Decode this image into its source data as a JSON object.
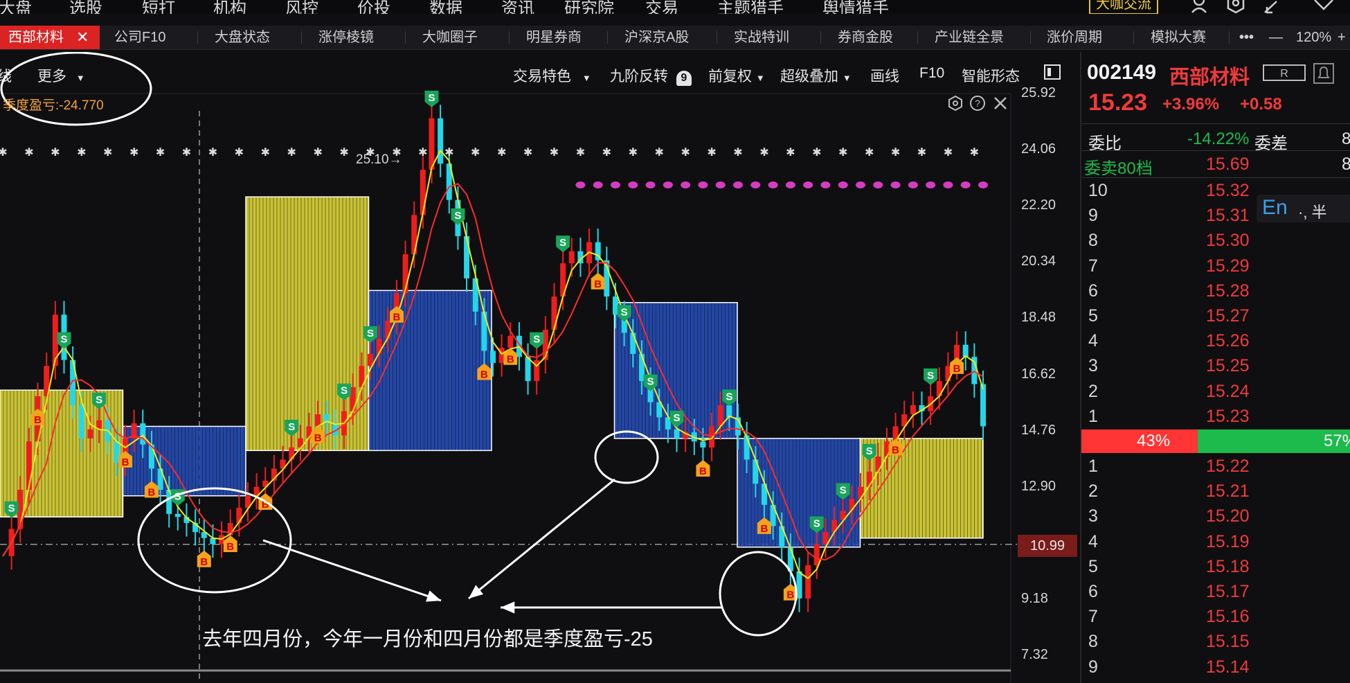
{
  "top_nav": {
    "items": [
      "大盘",
      "选股",
      "短打",
      "机构",
      "风控",
      "价投",
      "数据",
      "资讯",
      "研究院",
      "交易",
      "主题猎手",
      "舆情猎手"
    ],
    "brand_button": "大咖交流"
  },
  "tabs": [
    {
      "label": "西部材料",
      "active": true
    },
    {
      "label": "公司F10"
    },
    {
      "label": "大盘状态"
    },
    {
      "label": "涨停棱镜"
    },
    {
      "label": "大咖圈子"
    },
    {
      "label": "明星券商"
    },
    {
      "label": "沪深京A股"
    },
    {
      "label": "实战特训"
    },
    {
      "label": "券商金股"
    },
    {
      "label": "产业链全景"
    },
    {
      "label": "涨价周期"
    },
    {
      "label": "模拟大赛"
    }
  ],
  "tabbar_right": {
    "more": "•••",
    "minus": "—",
    "zoom": "120%",
    "plus": "+"
  },
  "toolbar": {
    "left_partial": "线",
    "more": "更多",
    "trade_feature": "交易特色",
    "nine_reverse": "九阶反转",
    "nine_badge": "9",
    "fuquan": "前复权",
    "overlay": "超级叠加",
    "draw": "画线",
    "f10": "F10",
    "smart_pattern": "智能形态"
  },
  "indicator_label": "季度盈亏:-24.770",
  "peak_label": "25.10→",
  "current_price_tag": "10.99",
  "annotation": "去年四月份，今年一月份和四月份都是季度盈亏-25",
  "colors": {
    "up": "#f01d1d",
    "down": "#22d8e8",
    "ma_yellow": "#f2ea12",
    "ma_red": "#ff2a2a",
    "bar_yellow": "#e9e23a",
    "bar_blue": "#2750bf",
    "buy_orange": "#f5a31b",
    "sell_green": "#18a55a",
    "accent_red": "#dc2323",
    "accent_green": "#1cbb4c"
  },
  "chart_data": {
    "type": "candlestick",
    "y_ticks": [
      25.92,
      24.06,
      22.2,
      20.34,
      18.48,
      16.62,
      14.76,
      12.9,
      9.18,
      7.32
    ],
    "ylim": [
      6.4,
      27.3
    ],
    "close_series": [
      10.6,
      11.5,
      12.8,
      14.4,
      15.9,
      16.9,
      18.6,
      17.1,
      15.6,
      14.5,
      14.8,
      15.1,
      14.4,
      13.7,
      14.5,
      15.0,
      14.3,
      13.5,
      12.8,
      12.0,
      11.9,
      11.7,
      11.4,
      11.2,
      11.0,
      11.3,
      11.7,
      12.2,
      12.6,
      12.9,
      13.1,
      13.5,
      13.8,
      14.2,
      14.5,
      14.9,
      15.3,
      15.0,
      14.6,
      15.4,
      16.2,
      16.9,
      17.3,
      17.8,
      18.4,
      19.3,
      20.6,
      21.9,
      23.4,
      25.1,
      23.6,
      22.4,
      21.2,
      19.8,
      18.7,
      17.4,
      17.0,
      17.5,
      17.9,
      17.2,
      16.4,
      17.1,
      18.1,
      19.2,
      20.3,
      20.7,
      20.3,
      21.0,
      20.4,
      19.2,
      18.6,
      18.0,
      17.3,
      16.4,
      15.7,
      15.2,
      14.8,
      14.5,
      14.7,
      14.4,
      14.2,
      14.9,
      15.6,
      15.2,
      14.6,
      13.8,
      13.0,
      12.3,
      11.6,
      10.9,
      10.1,
      9.2,
      10.3,
      11.0,
      11.4,
      11.8,
      12.1,
      12.5,
      12.9,
      13.4,
      13.9,
      14.4,
      14.9,
      15.3,
      15.6,
      15.4,
      15.9,
      16.4,
      16.9,
      17.6,
      17.2,
      16.3,
      14.9
    ],
    "step_bands": [
      {
        "color": "yellow",
        "top": 16.1,
        "base": 11.9
      },
      {
        "color": "blue",
        "top": 14.9,
        "base": 12.6
      },
      {
        "color": "yellow",
        "top": 22.5,
        "base": 14.1
      },
      {
        "color": "blue",
        "top": 19.4,
        "base": 14.1
      },
      {
        "color": "blue",
        "top": 19.0,
        "base": 19.0
      },
      {
        "color": "blue",
        "top": 19.0,
        "base": 14.5
      },
      {
        "color": "blue",
        "top": 14.5,
        "base": 10.9
      },
      {
        "color": "yellow",
        "top": 14.5,
        "base": 11.2
      }
    ],
    "signals": [
      {
        "t": "S"
      },
      {
        "t": "B"
      },
      {
        "t": "S"
      },
      {
        "t": "S"
      },
      {
        "t": "B"
      },
      {
        "t": "B"
      },
      {
        "t": "S"
      },
      {
        "t": "B"
      },
      {
        "t": "B"
      },
      {
        "t": "B"
      },
      {
        "t": "S"
      },
      {
        "t": "B"
      },
      {
        "t": "S"
      },
      {
        "t": "S"
      },
      {
        "t": "B"
      },
      {
        "t": "S"
      },
      {
        "t": "S"
      },
      {
        "t": "B"
      },
      {
        "t": "B"
      },
      {
        "t": "S"
      },
      {
        "t": "S"
      },
      {
        "t": "B"
      },
      {
        "t": "S"
      },
      {
        "t": "S"
      },
      {
        "t": "S"
      },
      {
        "t": "B"
      },
      {
        "t": "S"
      },
      {
        "t": "B"
      },
      {
        "t": "B"
      },
      {
        "t": "S"
      },
      {
        "t": "S"
      },
      {
        "t": "S"
      },
      {
        "t": "B"
      },
      {
        "t": "S"
      },
      {
        "t": "B"
      }
    ]
  },
  "quote": {
    "code": "002149",
    "name": "西部材料",
    "badge": "R",
    "price": "15.23",
    "change_pct": "+3.96%",
    "change": "+0.58",
    "weibi_label": "委比",
    "weibi_value": "-14.22%",
    "weicha_label": "委差",
    "weicha_value": "8",
    "sell80_label": "委卖80档",
    "sell80_price": "15.69",
    "sell80_qty": "8",
    "asks": [
      {
        "level": "10",
        "price": "15.32"
      },
      {
        "level": "9",
        "price": "15.31"
      },
      {
        "level": "8",
        "price": "15.30"
      },
      {
        "level": "7",
        "price": "15.29"
      },
      {
        "level": "6",
        "price": "15.28"
      },
      {
        "level": "5",
        "price": "15.27"
      },
      {
        "level": "4",
        "price": "15.26"
      },
      {
        "level": "3",
        "price": "15.25"
      },
      {
        "level": "2",
        "price": "15.24"
      },
      {
        "level": "1",
        "price": "15.23"
      }
    ],
    "ratio_red": "43%",
    "ratio_green": "57%",
    "ratio_red_fraction": 0.43,
    "bids": [
      {
        "level": "1",
        "price": "15.22"
      },
      {
        "level": "2",
        "price": "15.21"
      },
      {
        "level": "3",
        "price": "15.20"
      },
      {
        "level": "4",
        "price": "15.19"
      },
      {
        "level": "5",
        "price": "15.18"
      },
      {
        "level": "6",
        "price": "15.17"
      },
      {
        "level": "7",
        "price": "15.16"
      },
      {
        "level": "8",
        "price": "15.15"
      },
      {
        "level": "9",
        "price": "15.14"
      }
    ],
    "ime": "En",
    "ime_extra": "·, 半"
  }
}
